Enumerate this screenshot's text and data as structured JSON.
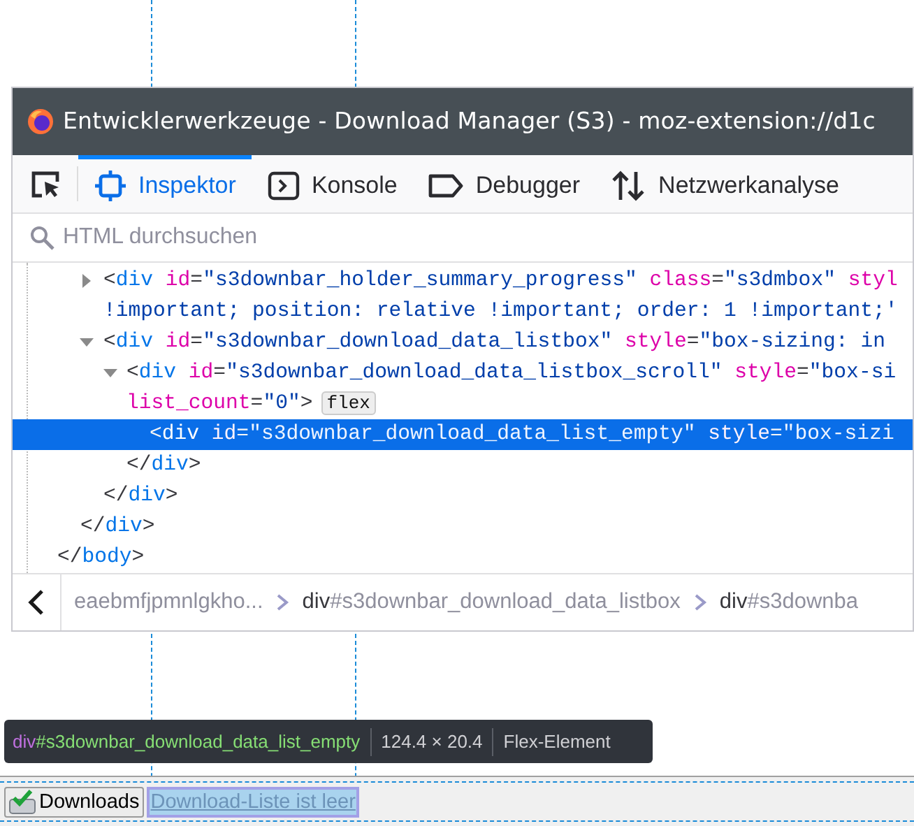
{
  "window": {
    "title": "Entwicklerwerkzeuge - Download Manager (S3) - moz-extension://d1c"
  },
  "tabs": [
    {
      "label": "Inspektor",
      "selected": true
    },
    {
      "label": "Konsole",
      "selected": false
    },
    {
      "label": "Debugger",
      "selected": false
    },
    {
      "label": "Netzwerkanalyse",
      "selected": false
    }
  ],
  "search": {
    "placeholder": "HTML durchsuchen"
  },
  "markup": [
    {
      "closing": [
        {
          "kind": "punct",
          "text": "</"
        },
        {
          "kind": "tag",
          "text": "body"
        },
        {
          "kind": "punct",
          "text": ">"
        }
      ],
      "children": [
        {
          "closing": [
            {
              "kind": "punct",
              "text": "</"
            },
            {
              "kind": "tag",
              "text": "div"
            },
            {
              "kind": "punct",
              "text": ">"
            }
          ],
          "children": [
            {
              "expanded": false,
              "selected": false,
              "lines": [
                [
                  {
                    "kind": "punct",
                    "text": "<"
                  },
                  {
                    "kind": "tag",
                    "text": "div"
                  },
                  {
                    "kind": "attr",
                    "text": " id"
                  },
                  {
                    "kind": "punct",
                    "text": "="
                  },
                  {
                    "kind": "value",
                    "text": "\"s3downbar_holder_summary_progress\""
                  },
                  {
                    "kind": "attr",
                    "text": " class"
                  },
                  {
                    "kind": "punct",
                    "text": "="
                  },
                  {
                    "kind": "value",
                    "text": "\"s3dmbox\""
                  },
                  {
                    "kind": "attr",
                    "text": " styl"
                  }
                ],
                [
                  {
                    "kind": "value",
                    "text": "!important; position: relative !important; order: 1 !important;'"
                  }
                ]
              ]
            },
            {
              "expanded": true,
              "selected": false,
              "lines": [
                [
                  {
                    "kind": "punct",
                    "text": "<"
                  },
                  {
                    "kind": "tag",
                    "text": "div"
                  },
                  {
                    "kind": "attr",
                    "text": " id"
                  },
                  {
                    "kind": "punct",
                    "text": "="
                  },
                  {
                    "kind": "value",
                    "text": "\"s3downbar_download_data_listbox\""
                  },
                  {
                    "kind": "attr",
                    "text": " style"
                  },
                  {
                    "kind": "punct",
                    "text": "="
                  },
                  {
                    "kind": "value",
                    "text": "\"box-sizing: in"
                  }
                ]
              ],
              "closing": [
                {
                  "kind": "punct",
                  "text": "</"
                },
                {
                  "kind": "tag",
                  "text": "div"
                },
                {
                  "kind": "punct",
                  "text": ">"
                }
              ],
              "children": [
                {
                  "expanded": true,
                  "selected": false,
                  "lines": [
                    [
                      {
                        "kind": "punct",
                        "text": "<"
                      },
                      {
                        "kind": "tag",
                        "text": "div"
                      },
                      {
                        "kind": "attr",
                        "text": " id"
                      },
                      {
                        "kind": "punct",
                        "text": "="
                      },
                      {
                        "kind": "value",
                        "text": "\"s3downbar_download_data_listbox_scroll\""
                      },
                      {
                        "kind": "attr",
                        "text": " style"
                      },
                      {
                        "kind": "punct",
                        "text": "="
                      },
                      {
                        "kind": "value",
                        "text": "\"box-si"
                      }
                    ],
                    [
                      {
                        "kind": "attr",
                        "text": "list_count"
                      },
                      {
                        "kind": "punct",
                        "text": "="
                      },
                      {
                        "kind": "value",
                        "text": "\"0\""
                      },
                      {
                        "kind": "punct",
                        "text": ">"
                      },
                      {
                        "kind": "badge",
                        "text": "flex"
                      }
                    ]
                  ],
                  "closing": [
                    {
                      "kind": "punct",
                      "text": "</"
                    },
                    {
                      "kind": "tag",
                      "text": "div"
                    },
                    {
                      "kind": "punct",
                      "text": ">"
                    }
                  ],
                  "children": [
                    {
                      "selected": true,
                      "lines": [
                        [
                          {
                            "kind": "punct",
                            "text": "<"
                          },
                          {
                            "kind": "tag",
                            "text": "div"
                          },
                          {
                            "kind": "attr",
                            "text": " id"
                          },
                          {
                            "kind": "punct",
                            "text": "="
                          },
                          {
                            "kind": "value",
                            "text": "\"s3downbar_download_data_list_empty\""
                          },
                          {
                            "kind": "attr",
                            "text": " style"
                          },
                          {
                            "kind": "punct",
                            "text": "="
                          },
                          {
                            "kind": "value",
                            "text": "\"box-sizi"
                          }
                        ]
                      ]
                    }
                  ]
                }
              ]
            }
          ]
        }
      ]
    }
  ],
  "breadcrumbs": [
    {
      "tag": "eaebmfjpmnlgkho..."
    },
    {
      "tag": "div",
      "id": "#s3downbar_download_data_listbox"
    },
    {
      "tag": "div",
      "id": "#s3downba"
    }
  ],
  "tooltip": {
    "tag": "div",
    "id": "#s3downbar_download_data_list_empty",
    "size": "124.4 × 20.4",
    "type": "Flex-Element"
  },
  "statusbar": {
    "button": "Downloads",
    "message": "Download-Liste ist leer"
  }
}
